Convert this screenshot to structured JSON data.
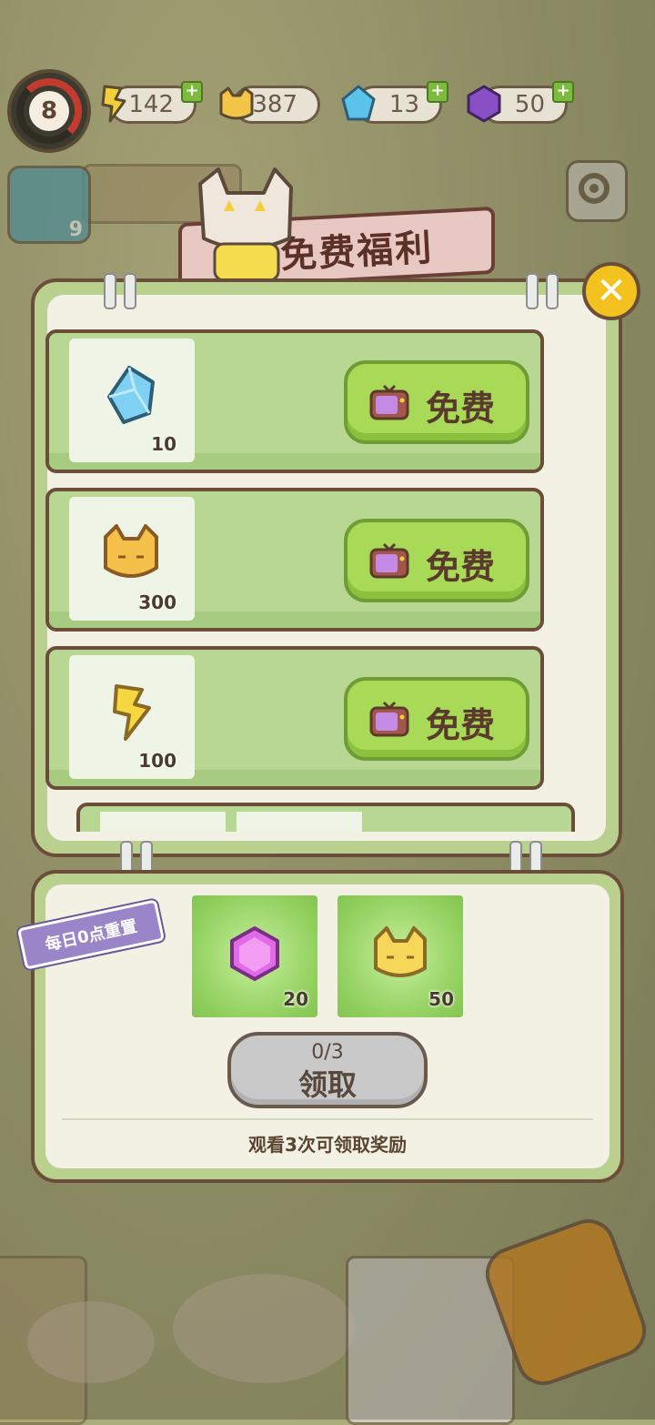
{
  "hud": {
    "level": "8",
    "energy": "142",
    "cat_coins": "387",
    "diamonds": "13",
    "gems": "50",
    "plus": "+"
  },
  "side": {
    "badge": "9"
  },
  "dialog": {
    "title": "免费福利",
    "close_label": "✕",
    "offers": [
      {
        "icon": "blue-diamond-icon",
        "amount": "10",
        "button": "免费"
      },
      {
        "icon": "cat-coin-icon",
        "amount": "300",
        "button": "免费"
      },
      {
        "icon": "energy-bolt-icon",
        "amount": "100",
        "button": "免费"
      }
    ]
  },
  "daily": {
    "reset_tag": "每日0点重置",
    "rewards": [
      {
        "icon": "purple-gem-icon",
        "amount": "20"
      },
      {
        "icon": "cat-coin-icon",
        "amount": "50"
      }
    ],
    "progress": "0/3",
    "claim_label": "领取",
    "hint": "观看3次可领取奖励"
  },
  "colors": {
    "panel_border": "#6b4e3a",
    "free_button": "#a8d957",
    "claim_disabled": "#c9c9c9",
    "close_button": "#f4c21f"
  }
}
